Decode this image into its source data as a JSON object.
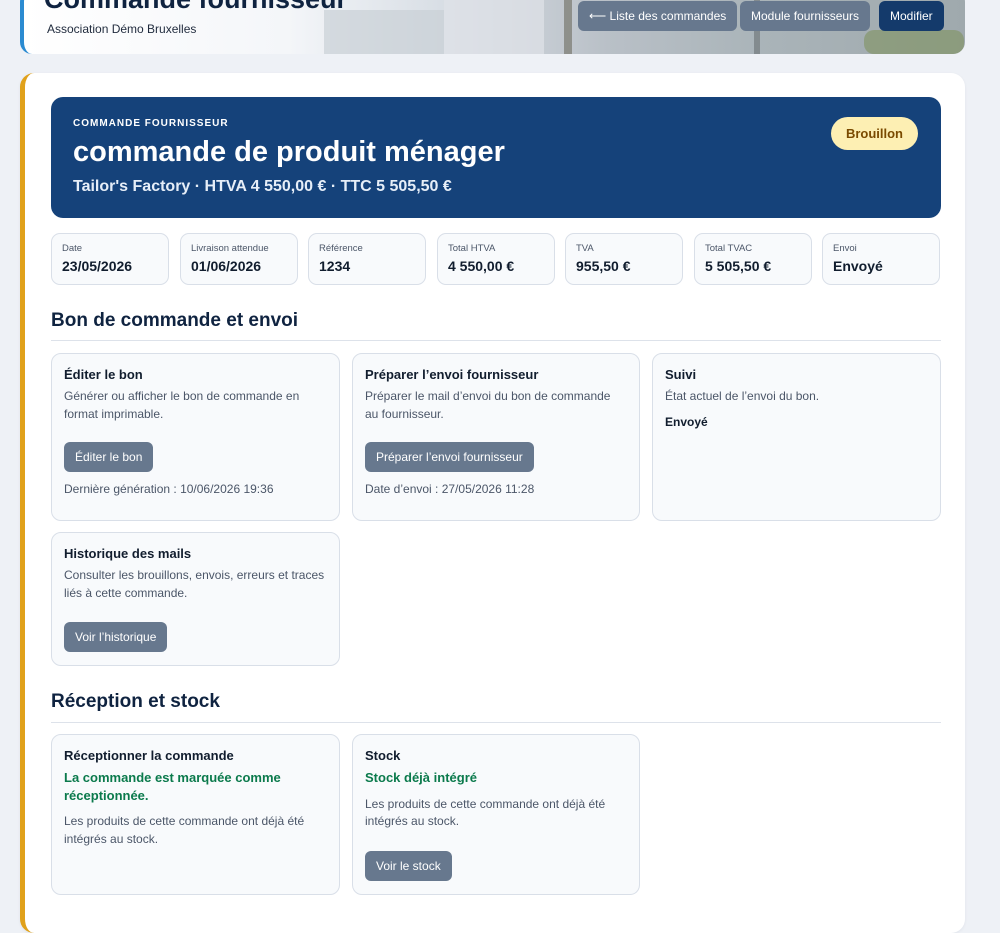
{
  "header": {
    "title": "Commande fournisseur",
    "organization": "Association Démo Bruxelles",
    "buttons": {
      "orders_list": "⟵ Liste des commandes",
      "suppliers_module": "Module fournisseurs",
      "edit": "Modifier"
    }
  },
  "hero": {
    "kicker": "COMMANDE FOURNISSEUR",
    "title": "commande de produit ménager",
    "subtitle": "Tailor's Factory · HTVA 4 550,00 € · TTC 5 505,50 €",
    "status_badge": "Brouillon"
  },
  "stats": [
    {
      "label": "Date",
      "value": "23/05/2026"
    },
    {
      "label": "Livraison attendue",
      "value": "01/06/2026"
    },
    {
      "label": "Référence",
      "value": "1234"
    },
    {
      "label": "Total HTVA",
      "value": "4 550,00 €"
    },
    {
      "label": "TVA",
      "value": "955,50 €"
    },
    {
      "label": "Total TVAC",
      "value": "5 505,50 €"
    },
    {
      "label": "Envoi",
      "value": "Envoyé"
    }
  ],
  "section_order": {
    "title": "Bon de commande et envoi",
    "edit_card": {
      "title": "Éditer le bon",
      "description": "Générer ou afficher le bon de commande en format imprimable.",
      "button": "Éditer le bon",
      "meta": "Dernière génération : 10/06/2026 19:36"
    },
    "send_card": {
      "title": "Préparer l’envoi fournisseur",
      "description": "Préparer le mail d’envoi du bon de commande au fournisseur.",
      "button": "Préparer l’envoi fournisseur",
      "meta": "Date d’envoi : 27/05/2026 11:28"
    },
    "tracking_card": {
      "title": "Suivi",
      "description": "État actuel de l’envoi du bon.",
      "status": "Envoyé"
    },
    "history_card": {
      "title": "Historique des mails",
      "description": "Consulter les brouillons, envois, erreurs et traces liés à cette commande.",
      "button": "Voir l’historique"
    }
  },
  "section_reception": {
    "title": "Réception et stock",
    "reception_card": {
      "title": "Réceptionner la commande",
      "status": "La commande est marquée comme réceptionnée.",
      "description": "Les produits de cette commande ont déjà été intégrés au stock."
    },
    "stock_card": {
      "title": "Stock",
      "status": "Stock déjà intégré",
      "description": "Les produits de cette commande ont déjà été intégrés au stock.",
      "button": "Voir le stock"
    }
  },
  "colors": {
    "hero_bg": "#15427a",
    "accent_left": "#e0a11b",
    "button_gray": "#67788e",
    "button_navy": "#143a6b",
    "success": "#0b7a4c",
    "badge_bg": "#fdefb3"
  }
}
